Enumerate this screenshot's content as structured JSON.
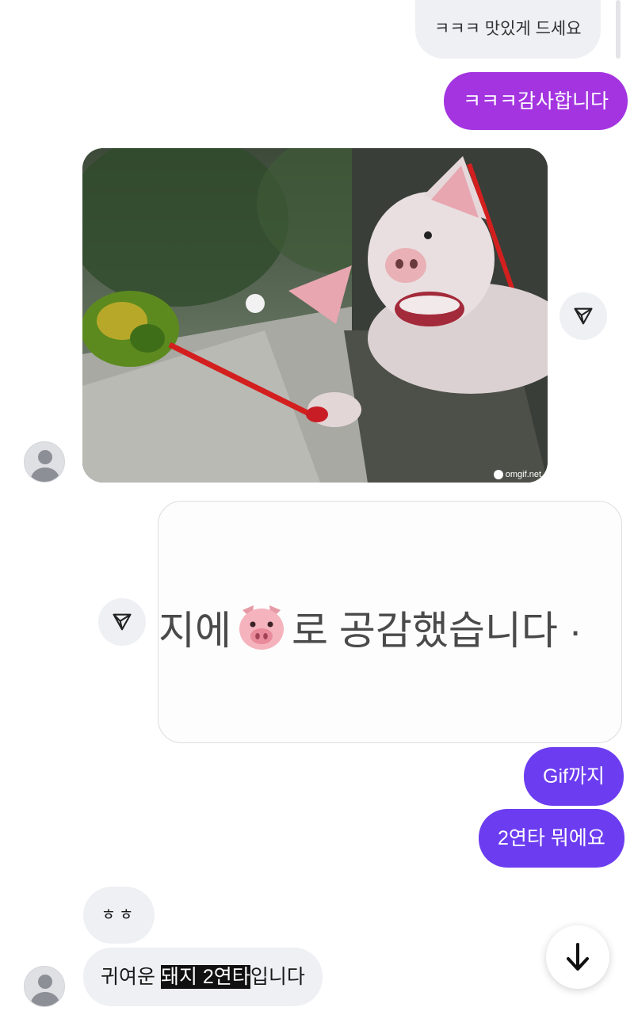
{
  "messages": [
    {
      "id": "m1",
      "sender": "other",
      "text": "ㅋㅋㅋ 맛있게 드세요"
    },
    {
      "id": "m2",
      "sender": "me",
      "text": "ㅋㅋㅋ감사합니다"
    },
    {
      "id": "m3",
      "sender": "other",
      "type": "gif",
      "watermark": "omgif.net"
    },
    {
      "id": "m4",
      "sender": "me",
      "type": "image",
      "line_prefix": "지에",
      "line_suffix": "로 공감했습니다 ·"
    },
    {
      "id": "m5",
      "sender": "me",
      "text": "Gif까지"
    },
    {
      "id": "m6",
      "sender": "me",
      "text": "2연타 뭐에요"
    },
    {
      "id": "m7",
      "sender": "other",
      "text": "ㅎㅎ"
    },
    {
      "id": "m8",
      "sender": "other",
      "text_before": "귀여운 ",
      "text_highlight": "돼지 2연타",
      "text_after": "입니다"
    }
  ],
  "icons": {
    "share": "share-icon",
    "scroll": "arrow-down-icon",
    "avatar": "avatar-icon",
    "reaction_emoji": "pig-face-emoji"
  },
  "colors": {
    "incoming_bubble": "#eff0f4",
    "outgoing_magenta": "#a334e0",
    "outgoing_violet": "#6c3cf0"
  }
}
